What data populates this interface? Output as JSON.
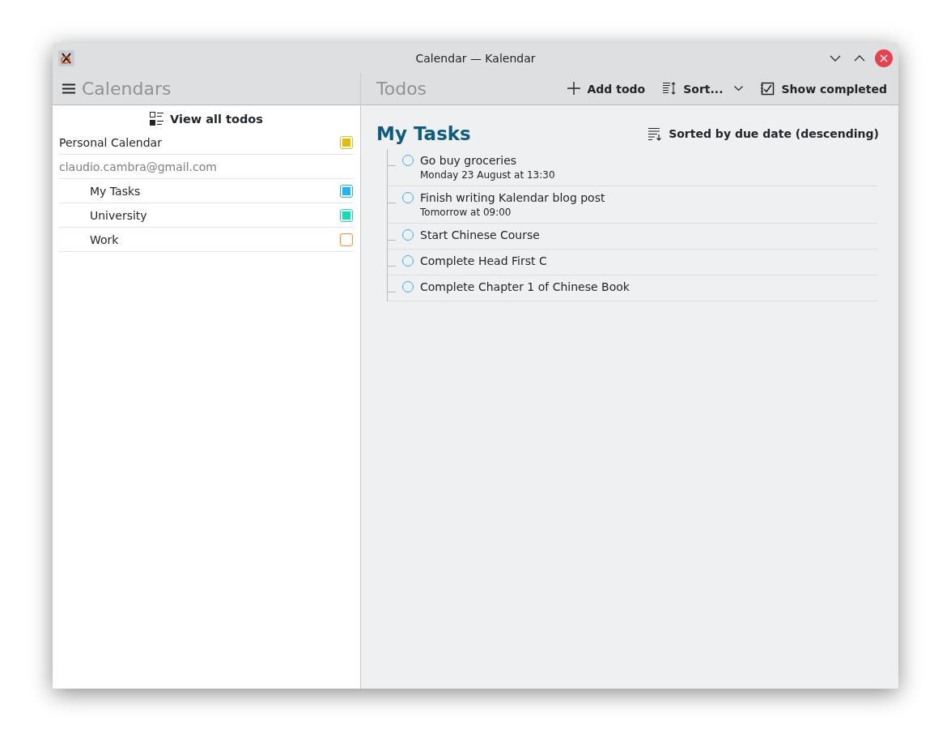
{
  "window": {
    "title": "Calendar — Kalendar"
  },
  "sidebar": {
    "title": "Calendars",
    "view_all": "View all todos",
    "items": [
      {
        "label": "Personal Calendar",
        "color": "#e8b90f",
        "checked": true
      },
      {
        "label": "claudio.cambra@gmail.com",
        "kind": "account",
        "children": [
          {
            "label": "My Tasks",
            "color": "#1eb4f5",
            "checked": true
          },
          {
            "label": "University",
            "color": "#11dfb2",
            "checked": true
          },
          {
            "label": "Work",
            "color": "#ff8a33",
            "checked": false
          }
        ]
      }
    ]
  },
  "toolbar": {
    "title": "Todos",
    "buttons": [
      {
        "kind": "add",
        "label": "Add todo"
      },
      {
        "kind": "sort",
        "label": "Sort..."
      },
      {
        "kind": "completed",
        "label": "Show completed"
      }
    ]
  },
  "list": {
    "title": "My Tasks",
    "sort_label": "Sorted by due date (descending)",
    "todos": [
      {
        "title": "Go buy groceries",
        "due": "Monday 23 August at 13:30",
        "completed": false
      },
      {
        "title": "Finish writing Kalendar blog post",
        "due": "Tomorrow at 09:00",
        "completed": false
      },
      {
        "title": "Start Chinese Course",
        "completed": false
      },
      {
        "title": "Complete Head First C",
        "completed": false
      },
      {
        "title": "Complete Chapter 1 of Chinese Book",
        "completed": false
      }
    ]
  }
}
